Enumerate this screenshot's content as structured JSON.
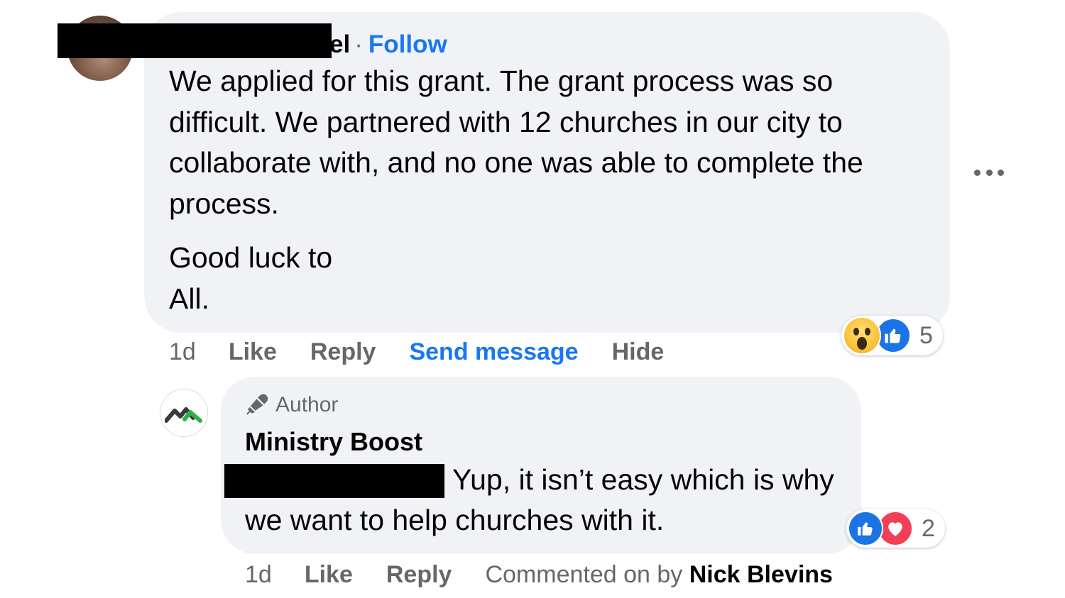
{
  "comment": {
    "author_suffix": "el",
    "separator": "·",
    "follow_label": "Follow",
    "paragraphs": [
      "We applied for this grant. The grant process was so difficult. We partnered with 12 churches in our city to collaborate with, and no one was able to complete the process.",
      "Good luck to\nAll."
    ],
    "reactions": {
      "icons": [
        "wow-emoji",
        "like-emoji"
      ],
      "count": "5"
    },
    "actions": {
      "timestamp": "1d",
      "like": "Like",
      "reply": "Reply",
      "send_message": "Send message",
      "hide": "Hide"
    }
  },
  "reply": {
    "badge": "Author",
    "name": "Ministry Boost",
    "text": "Yup, it isn’t easy which is why we want to help churches with it.",
    "reactions": {
      "icons": [
        "like-emoji",
        "love-emoji"
      ],
      "count": "2"
    },
    "actions": {
      "timestamp": "1d",
      "like": "Like",
      "reply": "Reply",
      "commented_prefix": "Commented on by",
      "commented_name": "Nick Blevins"
    }
  },
  "colors": {
    "bubble": "#f0f2f5",
    "link_blue": "#1877f2",
    "muted": "#65676b",
    "like_blue": "#1b74e4",
    "love_red": "#f33e58"
  }
}
